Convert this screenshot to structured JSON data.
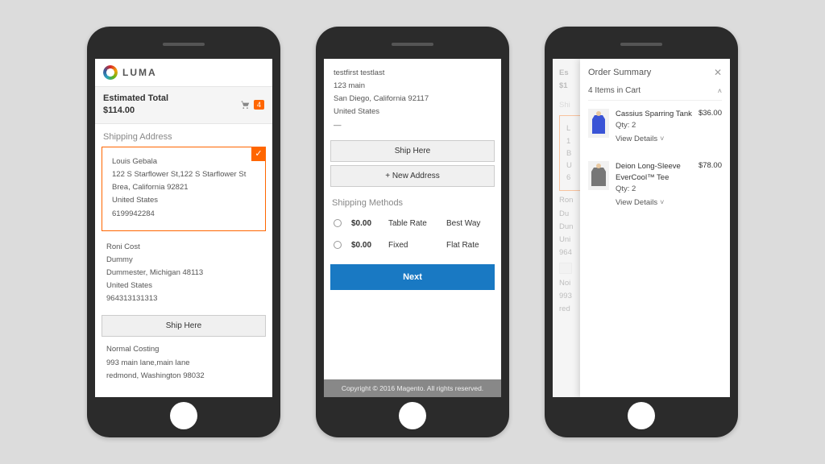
{
  "brand": "LUMA",
  "phone1": {
    "est_label": "Estimated Total",
    "est_amount": "$114.00",
    "cart_count": "4",
    "section_title": "Shipping Address",
    "addresses": [
      {
        "name": "Louis Gebala",
        "street": "122 S Starflower St,122 S Starflower St",
        "city": "Brea, California 92821",
        "country": "United States",
        "phone": "6199942284"
      },
      {
        "name": "Roni Cost",
        "line2": "Dummy",
        "city": "Dummester, Michigan 48113",
        "country": "United States",
        "phone": "964313131313"
      },
      {
        "name": "Normal Costing",
        "street": "993 main lane,main lane",
        "city": "redmond, Washington 98032"
      }
    ],
    "ship_here_label": "Ship Here"
  },
  "phone2": {
    "address": {
      "name": "testfirst testlast",
      "street": "123 main",
      "city": "San Diego, California 92117",
      "country": "United States",
      "extra": "—"
    },
    "ship_here_label": "Ship Here",
    "new_addr_label": "+ New Address",
    "methods_title": "Shipping Methods",
    "methods": [
      {
        "price": "$0.00",
        "name": "Table Rate",
        "carrier": "Best Way"
      },
      {
        "price": "$0.00",
        "name": "Fixed",
        "carrier": "Flat Rate"
      }
    ],
    "next_label": "Next",
    "footer": "Copyright © 2016 Magento. All rights reserved."
  },
  "phone3": {
    "under": {
      "est_short": "Es",
      "amount_short": "$1",
      "sect_short": "Shi",
      "box_lines": [
        "L",
        "1",
        "B",
        "U",
        "6"
      ],
      "lines_below": [
        "Ron",
        "Du",
        "Dun",
        "Uni",
        "964"
      ],
      "lines2": [
        "Noi",
        "993",
        "red"
      ]
    },
    "summary_title": "Order Summary",
    "items_in_cart": "4 Items in Cart",
    "items": [
      {
        "name": "Cassius Sparring Tank",
        "qty": "Qty: 2",
        "price": "$36.00"
      },
      {
        "name": "Deion Long-Sleeve EverCool&trade; Tee",
        "qty": "Qty: 2",
        "price": "$78.00"
      }
    ],
    "view_details": "View Details"
  }
}
